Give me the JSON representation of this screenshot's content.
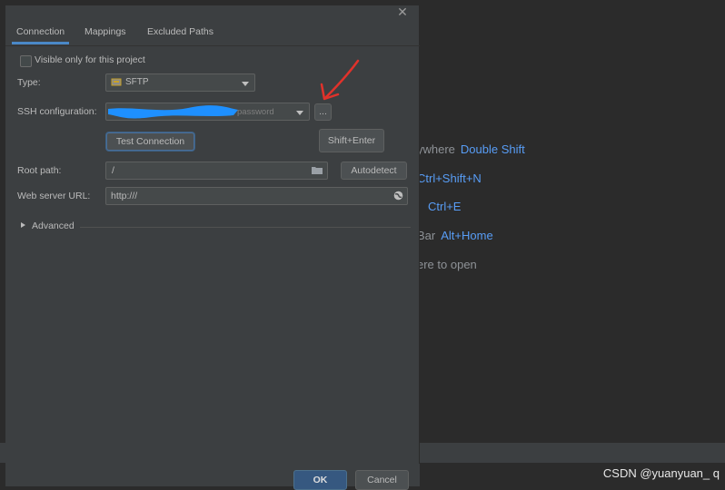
{
  "dialog": {
    "tabs": [
      "Connection",
      "Mappings",
      "Excluded Paths"
    ],
    "visible_only_label": "Visible only for this project",
    "type_label": "Type:",
    "type_value": "SFTP",
    "ssh_label": "SSH configuration:",
    "ssh_value": "password",
    "ssh_browse": "...",
    "test_connection": "Test Connection",
    "shift_enter": "Shift+Enter",
    "root_path_label": "Root path:",
    "root_path_value": "/",
    "autodetect": "Autodetect",
    "web_url_label": "Web server URL:",
    "web_url_value": "http:///",
    "advanced": "Advanced",
    "ok": "OK",
    "cancel": "Cancel"
  },
  "background_hints": [
    {
      "text": "ywhere",
      "key": "Double Shift"
    },
    {
      "text": "",
      "key": "Ctrl+Shift+N"
    },
    {
      "text": "",
      "key": "Ctrl+E"
    },
    {
      "text": "Bar",
      "key": "Alt+Home"
    },
    {
      "text": "ere to open",
      "key": ""
    }
  ],
  "watermark": "CSDN @yuanyuan_ q",
  "colors": {
    "accent": "#4a88c7",
    "hint_key": "#589df6",
    "annotation_arrow": "#e0322b",
    "scribble": "#1e90ff"
  }
}
